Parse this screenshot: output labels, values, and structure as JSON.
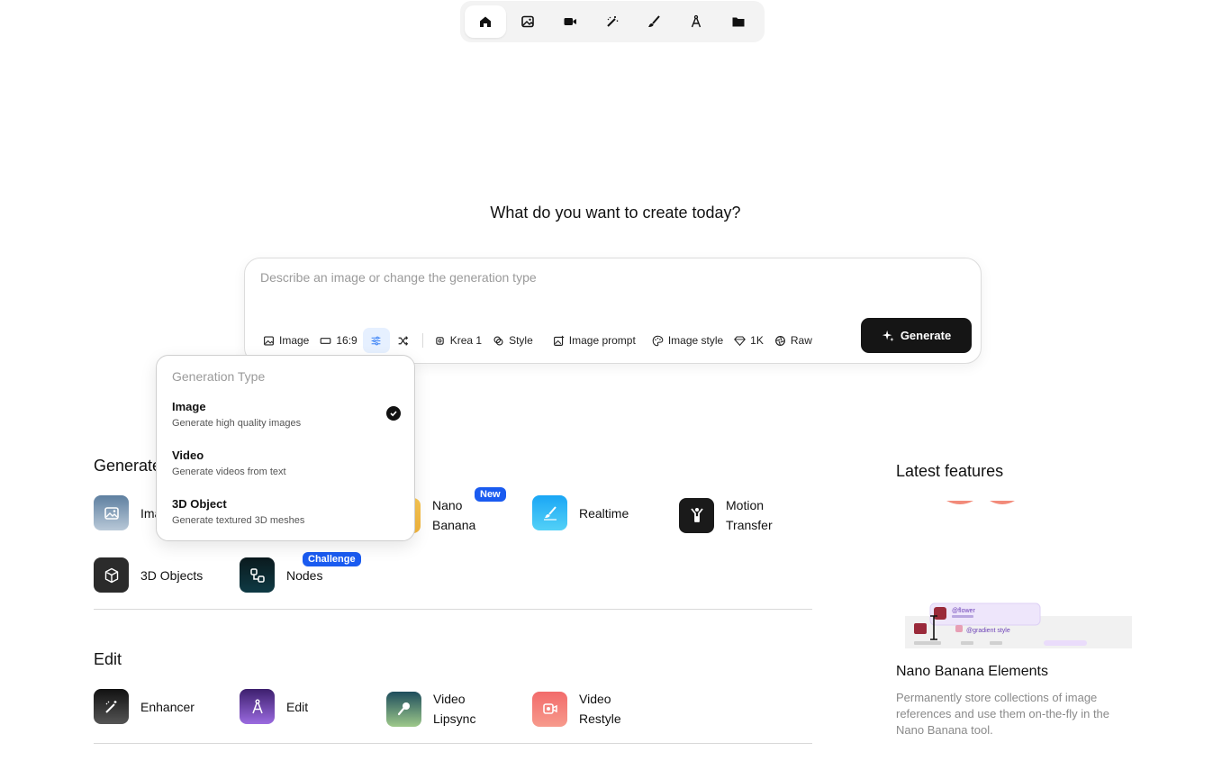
{
  "nav": {
    "items": [
      {
        "name": "home",
        "icon": "home-icon"
      },
      {
        "name": "image",
        "icon": "image-icon"
      },
      {
        "name": "video",
        "icon": "video-camera-icon"
      },
      {
        "name": "enhance",
        "icon": "magic-wand-icon"
      },
      {
        "name": "edit",
        "icon": "brush-icon"
      },
      {
        "name": "3d",
        "icon": "compass-icon"
      },
      {
        "name": "assets",
        "icon": "folder-icon"
      }
    ],
    "active": "home"
  },
  "headline": "What do you want to create today?",
  "prompt": {
    "placeholder": "Describe an image or change the generation type",
    "toolbar": {
      "type": "Image",
      "aspect": "16:9",
      "model": "Krea 1",
      "style": "Style",
      "image_prompt": "Image prompt",
      "image_style": "Image style",
      "resolution": "1K",
      "raw": "Raw"
    },
    "generate": "Generate"
  },
  "dropdown": {
    "heading": "Generation Type",
    "options": [
      {
        "title": "Image",
        "desc": "Generate high quality images",
        "selected": true
      },
      {
        "title": "Video",
        "desc": "Generate videos from text",
        "selected": false
      },
      {
        "title": "3D Object",
        "desc": "Generate textured 3D meshes",
        "selected": false
      }
    ]
  },
  "generate_section": {
    "title": "Generate",
    "tools": [
      {
        "label": "Image"
      },
      {
        "label": "Nano Banana",
        "badge": "New"
      },
      {
        "label": "Realtime"
      },
      {
        "label": "Motion Transfer"
      },
      {
        "label": "3D Objects"
      },
      {
        "label": "Nodes",
        "badge": "Challenge"
      }
    ]
  },
  "edit_section": {
    "title": "Edit",
    "tools": [
      {
        "label": "Enhancer"
      },
      {
        "label": "Edit"
      },
      {
        "label": "Video Lipsync"
      },
      {
        "label": "Video Restyle"
      }
    ]
  },
  "latest": {
    "title": "Latest features",
    "feature_name": "Nano Banana Elements",
    "feature_desc": "Permanently store collections of image references and use them on-the-fly in the Nano Banana tool.",
    "art_labels": {
      "flower": "@flower",
      "gradient": "@gradient style"
    }
  },
  "colors": {
    "accent_blue": "#1a5bf0",
    "dark": "#151515",
    "selected_bg": "#e6f0ff"
  }
}
